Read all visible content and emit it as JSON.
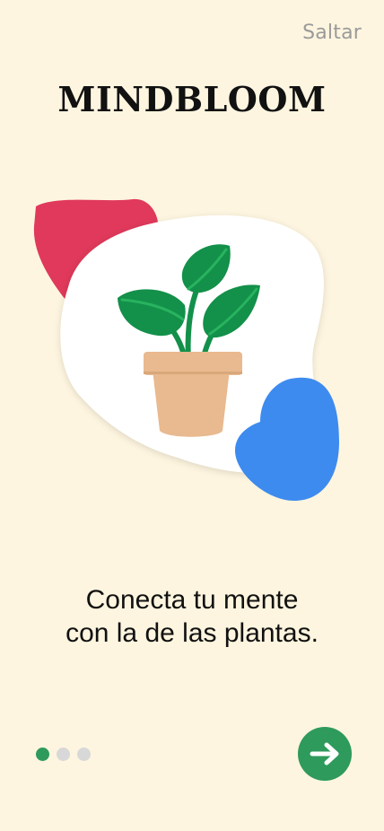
{
  "header": {
    "skip_label": "Saltar"
  },
  "brand": {
    "title": "MINDBLOOM"
  },
  "onboarding": {
    "headline_line1": "Conecta tu mente",
    "headline_line2": "con la de las plantas.",
    "current_page": 1,
    "total_pages": 3,
    "illustration_icon": "potted-plant-icon",
    "next_icon": "arrow-right-icon"
  },
  "colors": {
    "background": "#FDF5DF",
    "accent_green": "#2E9A5C",
    "blob_red": "#E0395B",
    "blob_blue": "#3D8BEF",
    "pot": "#E9B98F",
    "leaf": "#13904A",
    "dot_inactive": "#D8D8D8"
  }
}
